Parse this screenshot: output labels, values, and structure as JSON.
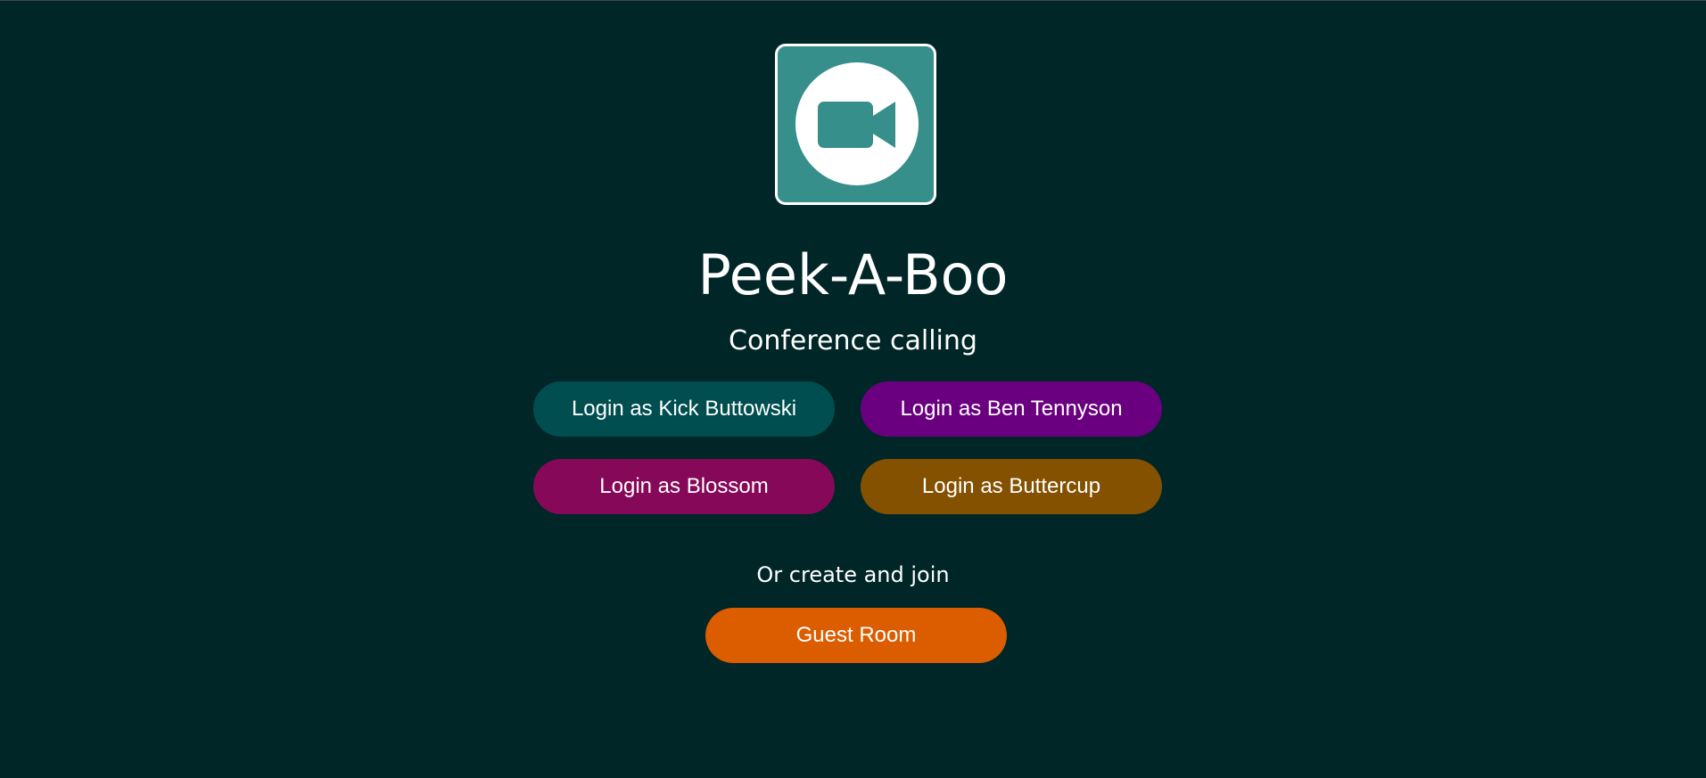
{
  "app": {
    "title": "Peek-A-Boo",
    "subtitle": "Conference calling",
    "logo_icon": "video-camera-icon"
  },
  "login": {
    "buttons": [
      {
        "label": "Login as Kick Buttowski",
        "color": "#004e50"
      },
      {
        "label": "Login as Ben Tennyson",
        "color": "#6a0080"
      },
      {
        "label": "Login as Blossom",
        "color": "#860859"
      },
      {
        "label": "Login as Buttercup",
        "color": "#835100"
      }
    ]
  },
  "guest": {
    "prompt": "Or create and join",
    "button_label": "Guest Room",
    "color": "#dc5c00"
  },
  "colors": {
    "background": "#002627",
    "logo_tile": "#368f8b",
    "text": "#ffffff"
  }
}
